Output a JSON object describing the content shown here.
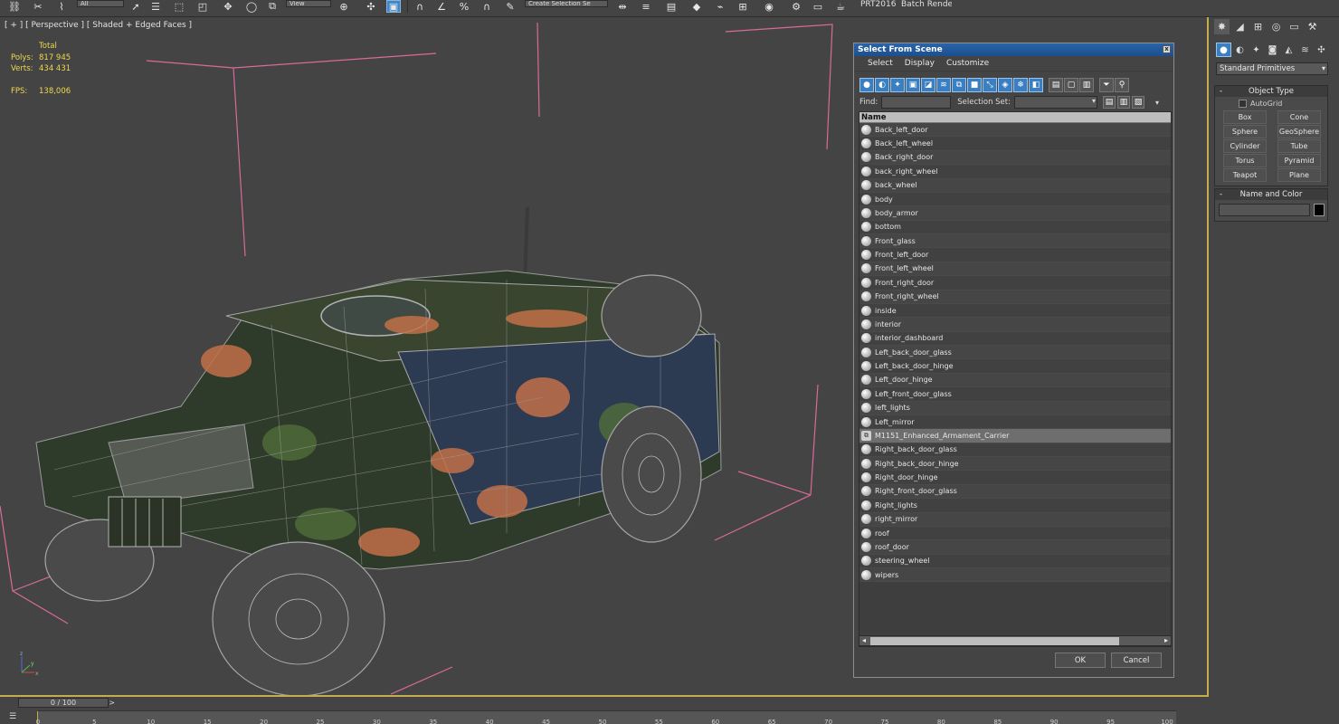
{
  "toolbar": {
    "filter_dropdown": "All",
    "view_dropdown": "View",
    "selection_set_placeholder": "Create Selection Se",
    "prt_label": "PRT2016",
    "batch_render_label": "Batch Render..."
  },
  "viewport": {
    "label": "[ + ] [ Perspective ] [ Shaded + Edged Faces ]",
    "stats": {
      "header": "Total",
      "polys_label": "Polys:",
      "polys_value": "817 945",
      "verts_label": "Verts:",
      "verts_value": "434 431",
      "fps_label": "FPS:",
      "fps_value": "138,006"
    },
    "axis_labels": {
      "z": "z",
      "y": "y",
      "x": "x"
    }
  },
  "dialog": {
    "title": "Select From Scene",
    "close_glyph": "x",
    "menu": [
      "Select",
      "Display",
      "Customize"
    ],
    "find_label": "Find:",
    "selection_set_label": "Selection Set:",
    "column_header": "Name",
    "items": [
      "Back_left_door",
      "Back_left_wheel",
      "Back_right_door",
      "back_right_wheel",
      "back_wheel",
      "body",
      "body_armor",
      "bottom",
      "Front_glass",
      "Front_left_door",
      "Front_left_wheel",
      "Front_right_door",
      "Front_right_wheel",
      "inside",
      "interior",
      "interior_dashboard",
      "Left_back_door_glass",
      "Left_back_door_hinge",
      "Left_door_hinge",
      "Left_front_door_glass",
      "left_lights",
      "Left_mirror",
      "M1151_Enhanced_Armament_Carrier",
      "Right_back_door_glass",
      "Right_back_door_hinge",
      "Right_door_hinge",
      "Right_front_door_glass",
      "Right_lights",
      "right_mirror",
      "roof",
      "roof_door",
      "steering_wheel",
      "wipers"
    ],
    "selected_index": 22,
    "group_index": 22,
    "ok_label": "OK",
    "cancel_label": "Cancel"
  },
  "command_panel": {
    "category_dropdown": "Standard Primitives",
    "object_type_title": "Object Type",
    "autogrid_label": "AutoGrid",
    "primitives": [
      "Box",
      "Cone",
      "Sphere",
      "GeoSphere",
      "Cylinder",
      "Tube",
      "Torus",
      "Pyramid",
      "Teapot",
      "Plane"
    ],
    "name_color_title": "Name and Color",
    "color": "#000000"
  },
  "timeline": {
    "slider_value": "0 / 100",
    "tick_labels": [
      "0",
      "5",
      "10",
      "15",
      "20",
      "25",
      "30",
      "35",
      "40",
      "45",
      "50",
      "55",
      "60",
      "65",
      "70",
      "75",
      "80",
      "85",
      "90",
      "95",
      "100"
    ]
  },
  "colors": {
    "viewport_border": "#c5ad4e",
    "stats_text": "#f0d84c",
    "bounding_box": "#d96a9a",
    "accent_blue": "#3a7fc1",
    "title_bar": "#1f5394"
  }
}
